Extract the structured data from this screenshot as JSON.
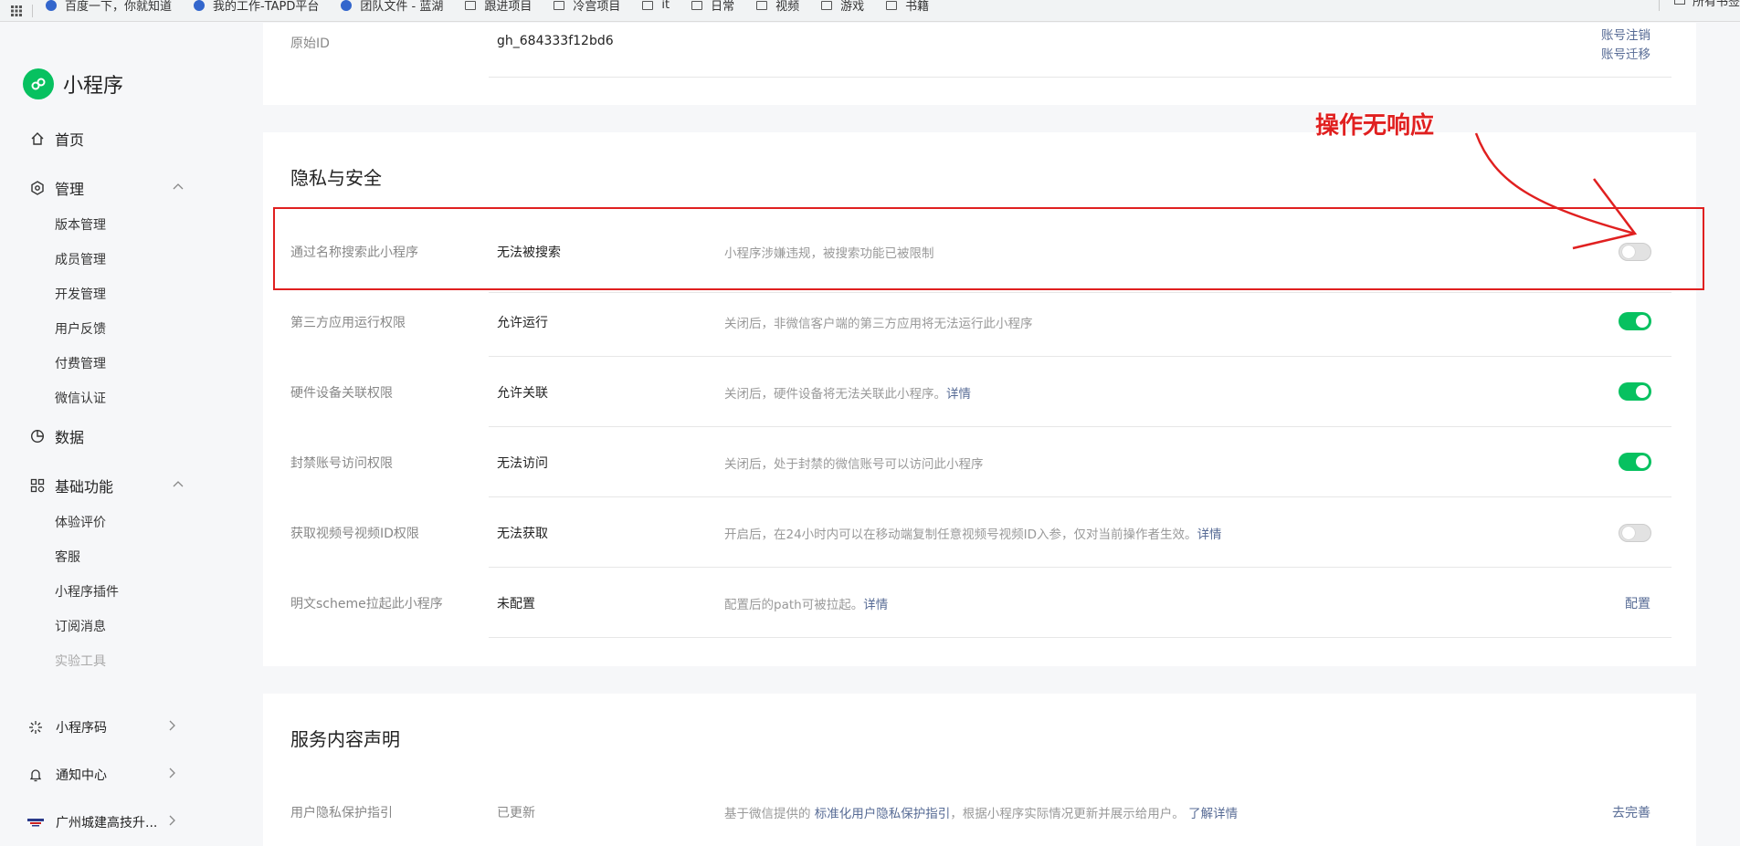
{
  "bookmarks": {
    "items": [
      {
        "label": "百度一下，你就知道",
        "icon": "paw-icon"
      },
      {
        "label": "我的工作-TAPD平台",
        "icon": "tapd-icon"
      },
      {
        "label": "团队文件 - 蓝湖",
        "icon": "lanhu-icon"
      },
      {
        "label": "跟进项目",
        "icon": "folder-icon"
      },
      {
        "label": "冷宫项目",
        "icon": "folder-icon"
      },
      {
        "label": "it",
        "icon": "folder-icon"
      },
      {
        "label": "日常",
        "icon": "folder-icon"
      },
      {
        "label": "视频",
        "icon": "folder-icon"
      },
      {
        "label": "游戏",
        "icon": "folder-icon"
      },
      {
        "label": "书籍",
        "icon": "folder-icon"
      }
    ],
    "right_label": "所有书签"
  },
  "sidebar": {
    "app_name": "小程序",
    "home": "首页",
    "manage": "管理",
    "manage_items": [
      "版本管理",
      "成员管理",
      "开发管理",
      "用户反馈",
      "付费管理",
      "微信认证"
    ],
    "data": "数据",
    "basic": "基础功能",
    "basic_items": [
      "体验评价",
      "客服",
      "小程序插件",
      "订阅消息",
      "实验工具"
    ],
    "qrcode": "小程序码",
    "notify": "通知中心",
    "account": "广州城建高技升..."
  },
  "top_card": {
    "label": "原始ID",
    "value": "gh_684333f12bd6",
    "link1": "账号注销",
    "link2": "账号迁移"
  },
  "privacy": {
    "title": "隐私与安全",
    "rows": [
      {
        "label": "通过名称搜索此小程序",
        "value": "无法被搜索",
        "desc": "小程序涉嫌违规，被搜索功能已被限制",
        "desc_link": "",
        "toggle": false
      },
      {
        "label": "第三方应用运行权限",
        "value": "允许运行",
        "desc": "关闭后，非微信客户端的第三方应用将无法运行此小程序",
        "desc_link": "",
        "toggle": true
      },
      {
        "label": "硬件设备关联权限",
        "value": "允许关联",
        "desc": "关闭后，硬件设备将无法关联此小程序。",
        "desc_link": "详情",
        "toggle": true
      },
      {
        "label": "封禁账号访问权限",
        "value": "无法访问",
        "desc": "关闭后，处于封禁的微信账号可以访问此小程序",
        "desc_link": "",
        "toggle": true
      },
      {
        "label": "获取视频号视频ID权限",
        "value": "无法获取",
        "desc": "开启后，在24小时内可以在移动端复制任意视频号视频ID入参，仅对当前操作者生效。",
        "desc_link": "详情",
        "toggle": false
      },
      {
        "label": "明文scheme拉起此小程序",
        "value": "未配置",
        "desc": "配置后的path可被拉起。",
        "desc_link": "详情",
        "action": "配置"
      }
    ]
  },
  "service": {
    "title": "服务内容声明",
    "row_label": "用户隐私保护指引",
    "row_value": "已更新",
    "desc_pre": "基于微信提供的",
    "desc_link": "标准化用户隐私保护指引",
    "desc_post": "，根据小程序实际情况更新并展示给用户。",
    "desc_link2": "了解详情",
    "action": "去完善"
  },
  "annotation": {
    "text": "操作无响应",
    "color": "#e02020"
  },
  "colors": {
    "accent_green": "#07c160",
    "link_blue": "#576b95"
  }
}
